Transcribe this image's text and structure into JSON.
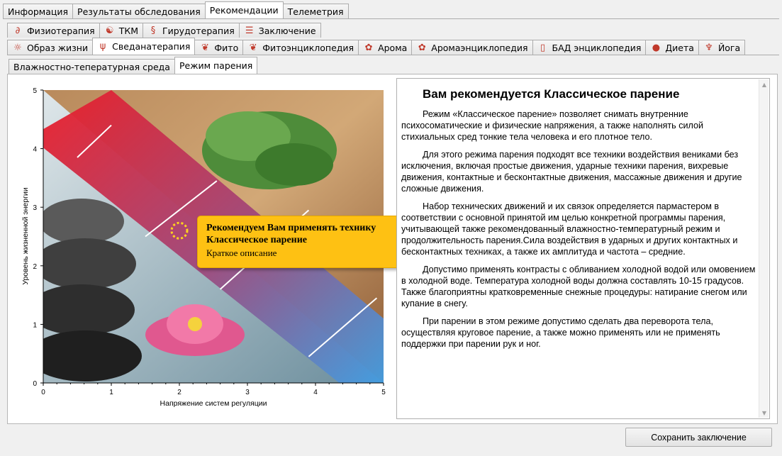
{
  "main_tabs": [
    "Информация",
    "Результаты обследования",
    "Рекомендации",
    "Телеметрия"
  ],
  "sub_tabs_row1": [
    {
      "label": "Физиотерапия",
      "icon": "physio-icon"
    },
    {
      "label": "ТКМ",
      "icon": "tcm-icon"
    },
    {
      "label": "Гирудотерапия",
      "icon": "leech-icon"
    },
    {
      "label": "Заключение",
      "icon": "document-icon"
    }
  ],
  "sub_tabs_row2": [
    {
      "label": "Образ жизни",
      "icon": "sun-icon"
    },
    {
      "label": "Сведанатерапия",
      "icon": "broom-icon"
    },
    {
      "label": "Фито",
      "icon": "leaf-icon"
    },
    {
      "label": "Фитоэнциклопедия",
      "icon": "leaf-book-icon"
    },
    {
      "label": "Арома",
      "icon": "flower-icon"
    },
    {
      "label": "Аромаэнциклопедия",
      "icon": "flower-book-icon"
    },
    {
      "label": "БАД энциклопедия",
      "icon": "bottle-icon"
    },
    {
      "label": "Диета",
      "icon": "apple-icon"
    },
    {
      "label": "Йога",
      "icon": "yoga-icon"
    }
  ],
  "inner_tabs": [
    "Влажностно-тепературная среда",
    "Режим парения"
  ],
  "chart_data": {
    "type": "zone-map",
    "xlabel": "Напряжение систем регуляции",
    "ylabel": "Уровень жизненной энергии",
    "xlim": [
      0,
      5
    ],
    "ylim": [
      0,
      5
    ],
    "xticks": [
      "0",
      "1",
      "2",
      "3",
      "4",
      "5"
    ],
    "yticks": [
      "0",
      "1",
      "2",
      "3",
      "4",
      "5"
    ],
    "marker": {
      "x": 2.0,
      "y": 2.6
    },
    "zone_colors": {
      "top": "#e8212b",
      "mid": "#9e4a7a",
      "bottom": "#3aa3e8"
    }
  },
  "callout": {
    "title": "Рекомендуем Вам применять технику Классическое парение",
    "subtitle": "Краткое описание"
  },
  "description": {
    "title": "Вам рекомендуется Классическое парение",
    "paragraphs": [
      "Режим «Классическое парение» позволяет снимать внутренние психосоматические и физические напряжения, а также наполнять силой стихиальных сред тонкие тела человека и его плотное тело.",
      "Для этого режима парения подходят все техники воздействия вениками без исключения, включая простые движения, ударные техники парения, вихревые движения, контактные и бесконтактные движения, массажные движения и другие сложные движения.",
      "Набор технических движений и их связок определяется пармастером в соответствии с основной принятой им целью конкретной программы парения, учитывающей также рекомендованный влажностно-температурный режим и продолжительность парения.Сила воздействия в ударных и других контактных и бесконтактных техниках, а также их амплитуда и частота – средние.",
      "Допустимо применять контрасты с обливанием холодной водой или омовением в холодной воде. Температура холодной воды должна составлять 10-15 градусов. Также благоприятны кратковременные снежные процедуры: натирание снегом или купание в снегу.",
      "При парении в этом режиме допустимо сделать два переворота тела, осуществляя круговое парение, а также можно применять или не применять поддержки при парении рук и ног."
    ]
  },
  "save_button": "Сохранить заключение"
}
